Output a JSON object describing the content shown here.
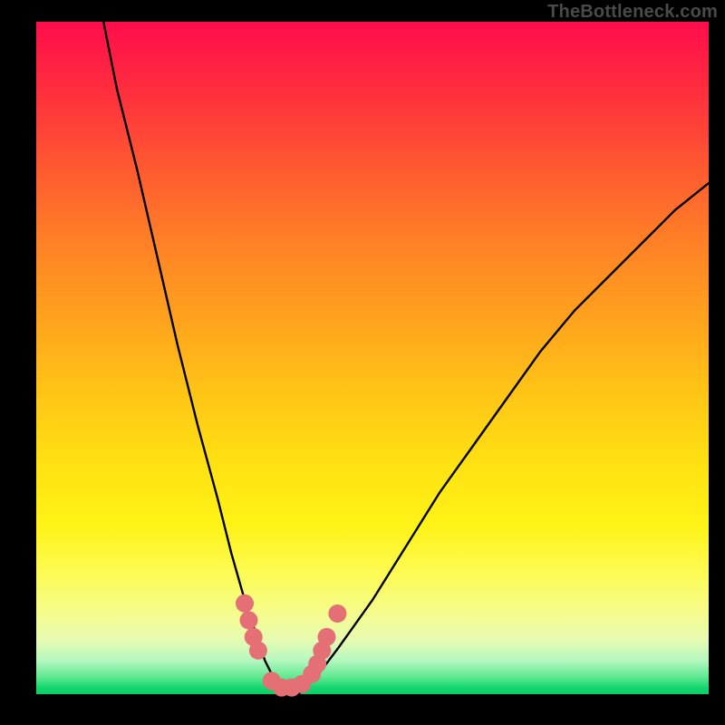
{
  "watermark": "TheBottleneck.com",
  "chart_data": {
    "type": "line",
    "title": "",
    "xlabel": "",
    "ylabel": "",
    "xlim": [
      0,
      100
    ],
    "ylim": [
      0,
      100
    ],
    "series": [
      {
        "name": "bottleneck-curve",
        "x": [
          10,
          12,
          15,
          18,
          21,
          24,
          27,
          29,
          31,
          33,
          34,
          35,
          36,
          37,
          38,
          39,
          40,
          42,
          45,
          50,
          55,
          60,
          65,
          70,
          75,
          80,
          85,
          90,
          95,
          100
        ],
        "values": [
          100,
          90,
          78,
          65,
          52,
          40,
          29,
          21,
          14,
          8,
          5,
          3,
          1,
          0,
          0,
          0,
          1,
          3,
          7,
          14,
          22,
          30,
          37,
          44,
          51,
          57,
          62,
          67,
          72,
          76
        ]
      }
    ],
    "markers": [
      {
        "name": "left-cluster-1",
        "x": 31.0,
        "y": 13.5
      },
      {
        "name": "left-cluster-2",
        "x": 31.6,
        "y": 11.0
      },
      {
        "name": "left-cluster-3",
        "x": 32.3,
        "y": 8.5
      },
      {
        "name": "left-cluster-4",
        "x": 33.0,
        "y": 6.5
      },
      {
        "name": "valley-1",
        "x": 35.0,
        "y": 2.0
      },
      {
        "name": "valley-2",
        "x": 36.5,
        "y": 1.0
      },
      {
        "name": "valley-3",
        "x": 38.0,
        "y": 1.0
      },
      {
        "name": "valley-4",
        "x": 39.5,
        "y": 1.5
      },
      {
        "name": "right-cluster-1",
        "x": 41.0,
        "y": 3.0
      },
      {
        "name": "right-cluster-2",
        "x": 41.8,
        "y": 4.5
      },
      {
        "name": "right-cluster-3",
        "x": 42.5,
        "y": 6.5
      },
      {
        "name": "right-cluster-4",
        "x": 43.2,
        "y": 8.5
      },
      {
        "name": "right-outlier",
        "x": 44.8,
        "y": 12.0
      }
    ],
    "marker_color": "#e46f75",
    "curve_color": "#000000"
  }
}
